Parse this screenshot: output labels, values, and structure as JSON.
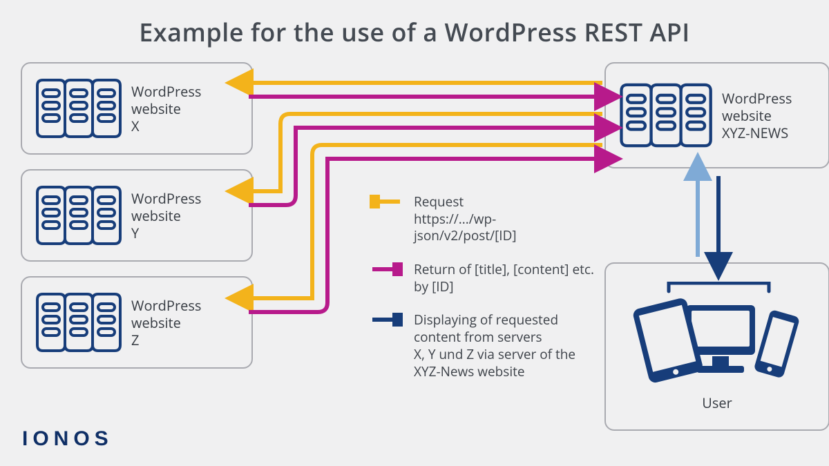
{
  "title": "Example for the use of a WordPress REST API",
  "nodes": {
    "x": "WordPress\nwebsite\nX",
    "y": "WordPress\nwebsite\nY",
    "z": "WordPress\nwebsite\nZ",
    "xyz": "WordPress\nwebsite\nXYZ-NEWS",
    "user": "User"
  },
  "legend": {
    "request": "Request\nhttps://.../wp-json/v2/post/[ID]",
    "return": "Return of [title], [content] etc.\nby [ID]",
    "display": "Displaying of requested\ncontent from servers\nX, Y und Z via server of the\nXYZ-News website"
  },
  "colors": {
    "request": "#f3b31b",
    "return": "#b71a8b",
    "display_dark": "#173d7a",
    "display_light": "#7faad6",
    "stroke": "#173d7a"
  },
  "brand": "IONOS"
}
